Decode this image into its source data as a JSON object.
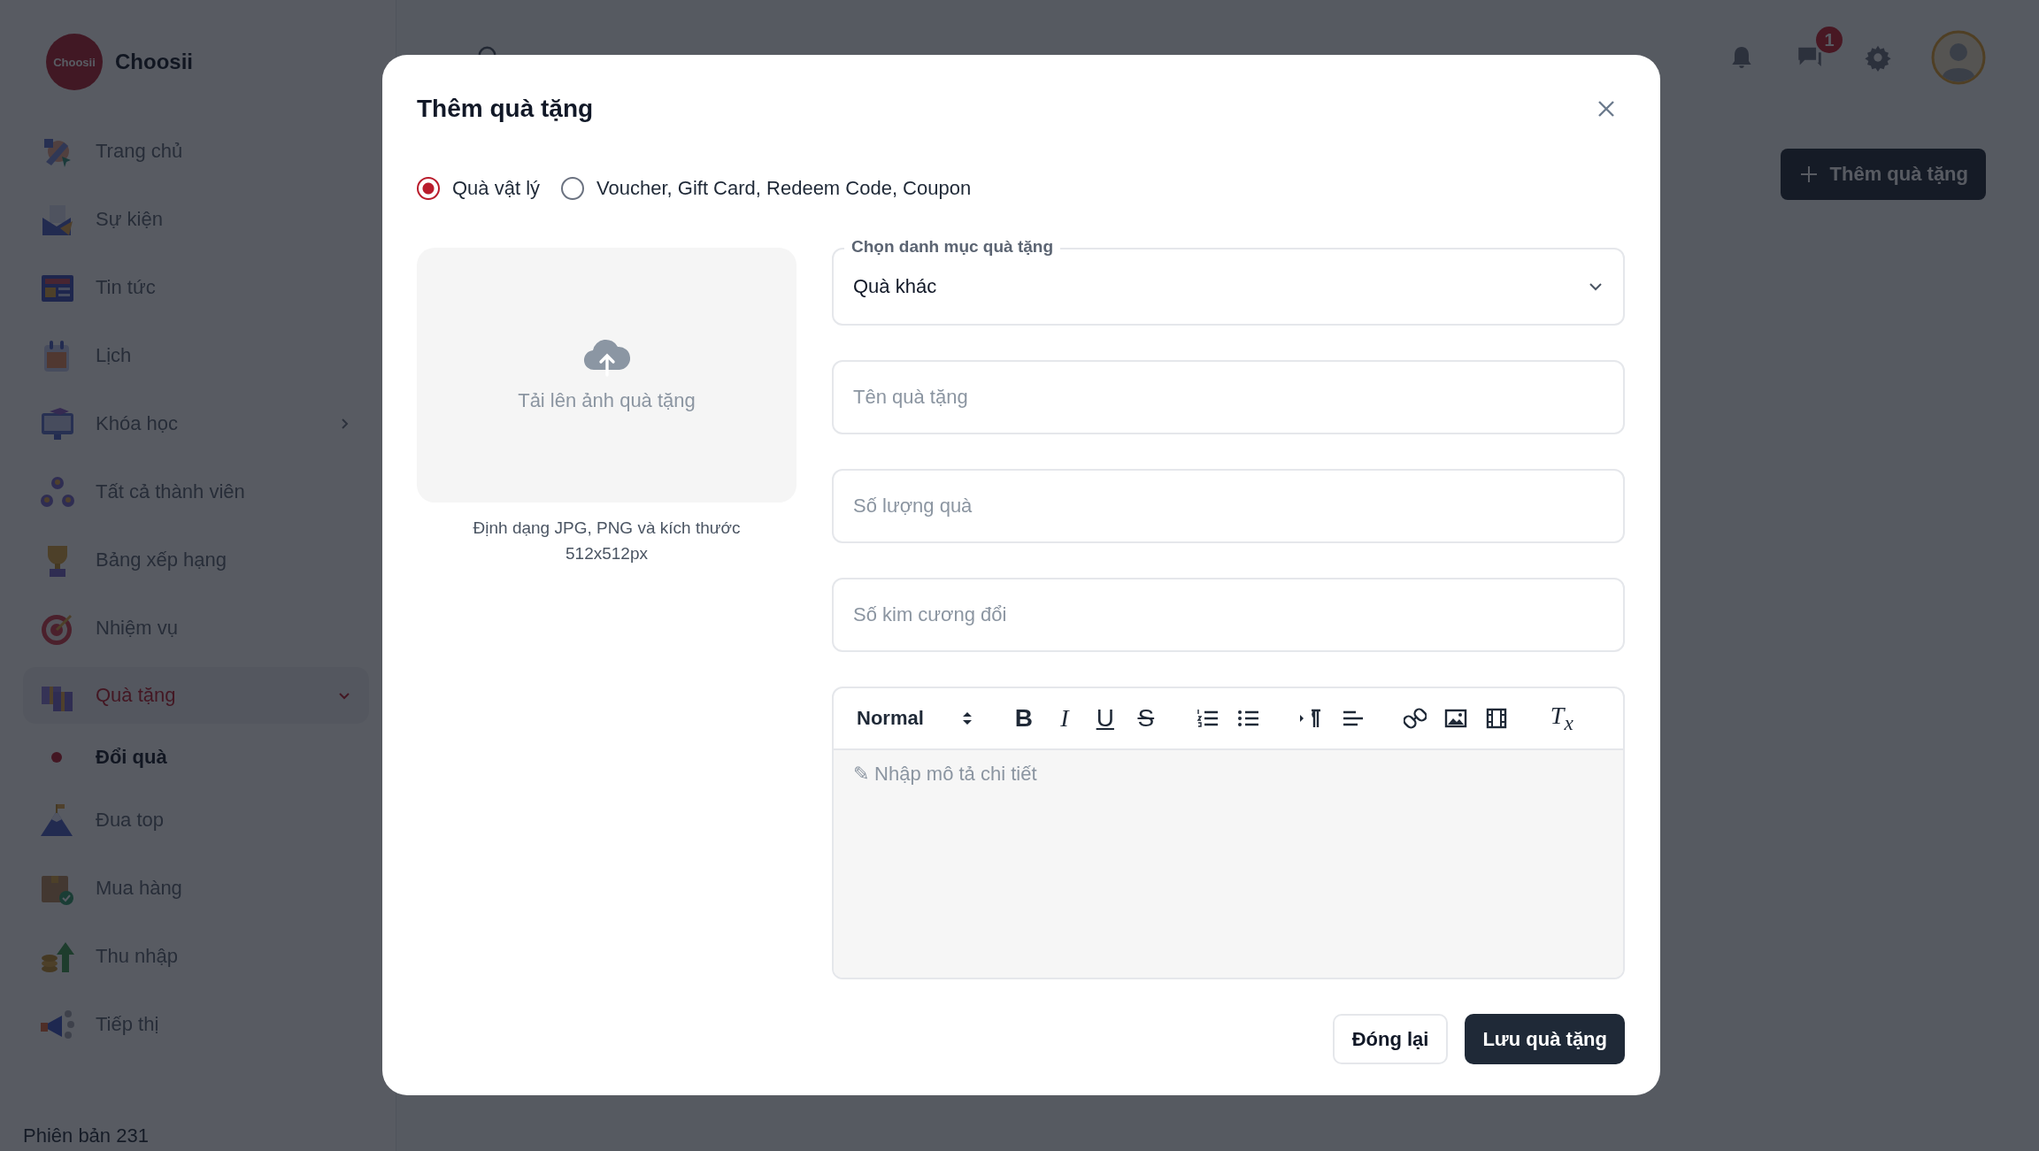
{
  "brand": {
    "logo_text": "Choosii",
    "name": "Choosii"
  },
  "sidebar": {
    "items": [
      {
        "label": "Trang chủ",
        "kind": "link",
        "selected": false
      },
      {
        "label": "Sự kiện",
        "kind": "link",
        "selected": false
      },
      {
        "label": "Tin tức",
        "kind": "link",
        "selected": false
      },
      {
        "label": "Lịch",
        "kind": "link",
        "selected": false
      },
      {
        "label": "Khóa học",
        "kind": "group",
        "selected": false,
        "expanded": false
      },
      {
        "label": "Tất cả thành viên",
        "kind": "link",
        "selected": false
      },
      {
        "label": "Bảng xếp hạng",
        "kind": "link",
        "selected": false
      },
      {
        "label": "Nhiệm vụ",
        "kind": "link",
        "selected": false
      },
      {
        "label": "Quà tặng",
        "kind": "group",
        "selected": true,
        "expanded": true,
        "children": [
          {
            "label": "Đổi quà",
            "selected": true
          }
        ]
      },
      {
        "label": "Đua top",
        "kind": "link",
        "selected": false
      },
      {
        "label": "Mua hàng",
        "kind": "link",
        "selected": false
      },
      {
        "label": "Thu nhập",
        "kind": "link",
        "selected": false
      },
      {
        "label": "Tiếp thị",
        "kind": "link",
        "selected": false
      }
    ],
    "version": "Phiên bản 231"
  },
  "header": {
    "chat_badge": "1",
    "add_button": "Thêm quà tặng"
  },
  "modal": {
    "title": "Thêm quà tặng",
    "gift_types": [
      {
        "label": "Quà vật lý",
        "selected": true
      },
      {
        "label": "Voucher, Gift Card, Redeem Code, Coupon",
        "selected": false
      }
    ],
    "upload": {
      "label": "Tải lên ảnh quà tặng",
      "hint": "Định dạng JPG, PNG và kích thước 512x512px"
    },
    "category": {
      "label": "Chọn danh mục quà tặng",
      "value": "Quà khác"
    },
    "fields": [
      {
        "placeholder": "Tên quà tặng"
      },
      {
        "placeholder": "Số lượng quà"
      },
      {
        "placeholder": "Số kim cương đổi"
      }
    ],
    "editor": {
      "format": "Normal",
      "marks": [
        "B",
        "I",
        "U",
        "S"
      ],
      "clear": "T$_{x}$",
      "placeholder": "✎ Nhập mô tả chi tiết"
    },
    "buttons": [
      {
        "label": "Đóng lại",
        "kind": "secondary"
      },
      {
        "label": "Lưu quà tặng",
        "kind": "primary"
      }
    ]
  }
}
